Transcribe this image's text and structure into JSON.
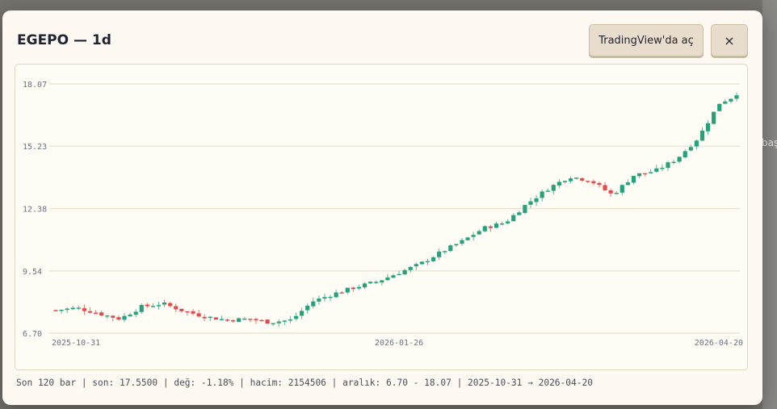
{
  "background": {
    "fragment_right": "başl"
  },
  "modal": {
    "title": "EGEPO — 1d",
    "open_tradingview_label": "TradingView'da aç",
    "close_label": "×",
    "footer_text": "Son 120 bar | son: 17.5500 | değ: -1.18% | hacim: 2154506 | aralık: 6.70 - 18.07 | 2025-10-31 → 2026-04-20"
  },
  "colors": {
    "up": "#26a17b",
    "down": "#e04b4b",
    "grid": "#ede3cf",
    "axis_text": "#6b7184"
  },
  "chart_data": {
    "type": "candlestick",
    "symbol": "EGEPO",
    "interval": "1d",
    "bar_count": 120,
    "ylim": [
      6.7,
      18.07
    ],
    "y_ticks": [
      "18.07",
      "15.23",
      "12.38",
      "9.54",
      "6.70"
    ],
    "y_tick_values": [
      18.07,
      15.23,
      12.38,
      9.54,
      6.7
    ],
    "x_ticks": [
      {
        "label": "2025-10-31",
        "index": 0
      },
      {
        "label": "2026-01-26",
        "index": 60
      },
      {
        "label": "2026-04-20",
        "index": 119
      }
    ],
    "last": 17.55,
    "change_pct": -1.18,
    "volume": 2154506,
    "close_path": [
      [
        0,
        7.75
      ],
      [
        5,
        7.85
      ],
      [
        10,
        7.6
      ],
      [
        15,
        7.35
      ],
      [
        20,
        7.9
      ],
      [
        25,
        8.05
      ],
      [
        30,
        7.7
      ],
      [
        35,
        7.45
      ],
      [
        40,
        7.3
      ],
      [
        45,
        7.35
      ],
      [
        50,
        7.2
      ],
      [
        55,
        7.3
      ],
      [
        60,
        8.15
      ],
      [
        65,
        8.5
      ],
      [
        70,
        8.8
      ],
      [
        75,
        9.05
      ],
      [
        80,
        9.45
      ],
      [
        85,
        9.85
      ],
      [
        90,
        10.4
      ],
      [
        95,
        10.9
      ],
      [
        100,
        11.5
      ],
      [
        105,
        11.75
      ],
      [
        110,
        12.6
      ],
      [
        115,
        13.3
      ],
      [
        120,
        13.85
      ],
      [
        125,
        13.65
      ],
      [
        130,
        13.0
      ],
      [
        135,
        13.9
      ],
      [
        140,
        14.1
      ],
      [
        145,
        14.65
      ],
      [
        150,
        15.6
      ],
      [
        155,
        17.2
      ],
      [
        159,
        17.55
      ]
    ]
  }
}
